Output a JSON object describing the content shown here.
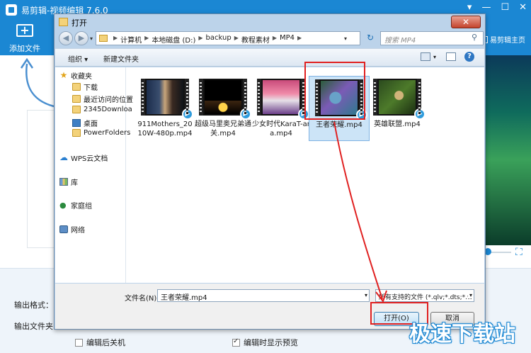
{
  "app": {
    "title": "易剪辑-视频编辑 7.6.0",
    "add_file_label": "添加文件",
    "homepage_label": "易剪辑主页",
    "output_format_label": "输出格式：",
    "output_folder_label": "输出文件夹",
    "checkbox_shutdown": "编辑后关机",
    "checkbox_preview": "编辑时显示预览",
    "accent_color": "#1b87d3"
  },
  "dialog": {
    "title": "打开",
    "breadcrumbs": [
      "计算机",
      "本地磁盘 (D:)",
      "backup",
      "教程素材",
      "MP4"
    ],
    "search_placeholder": "搜索 MP4",
    "toolbar": {
      "organize": "组织 ▾",
      "new_folder": "新建文件夹"
    },
    "sidebar": {
      "favorites": "收藏夹",
      "downloads": "下载",
      "recent": "最近访问的位置",
      "download2345": "2345Downloa",
      "desktop": "桌面",
      "powerfolders": "PowerFolders",
      "wps": "WPS云文档",
      "library": "库",
      "homegroup": "家庭组",
      "network": "网络"
    },
    "files": [
      {
        "name": "911Mothers_2010W-480p.mp4"
      },
      {
        "name": "超级马里奥兄弟通关.mp4"
      },
      {
        "name": "少女时代KaraT-ara.mp4"
      },
      {
        "name": "王者荣耀.mp4",
        "selected": true
      },
      {
        "name": "英雄联盟.mp4"
      }
    ],
    "filename_label": "文件名(N):",
    "filename_value": "王者荣耀.mp4",
    "filetype_value": "所有支持的文件 (*.qlv;*.dts;*.w",
    "open_button": "打开(O)",
    "cancel_button": "取消"
  },
  "watermark": "极速下载站"
}
